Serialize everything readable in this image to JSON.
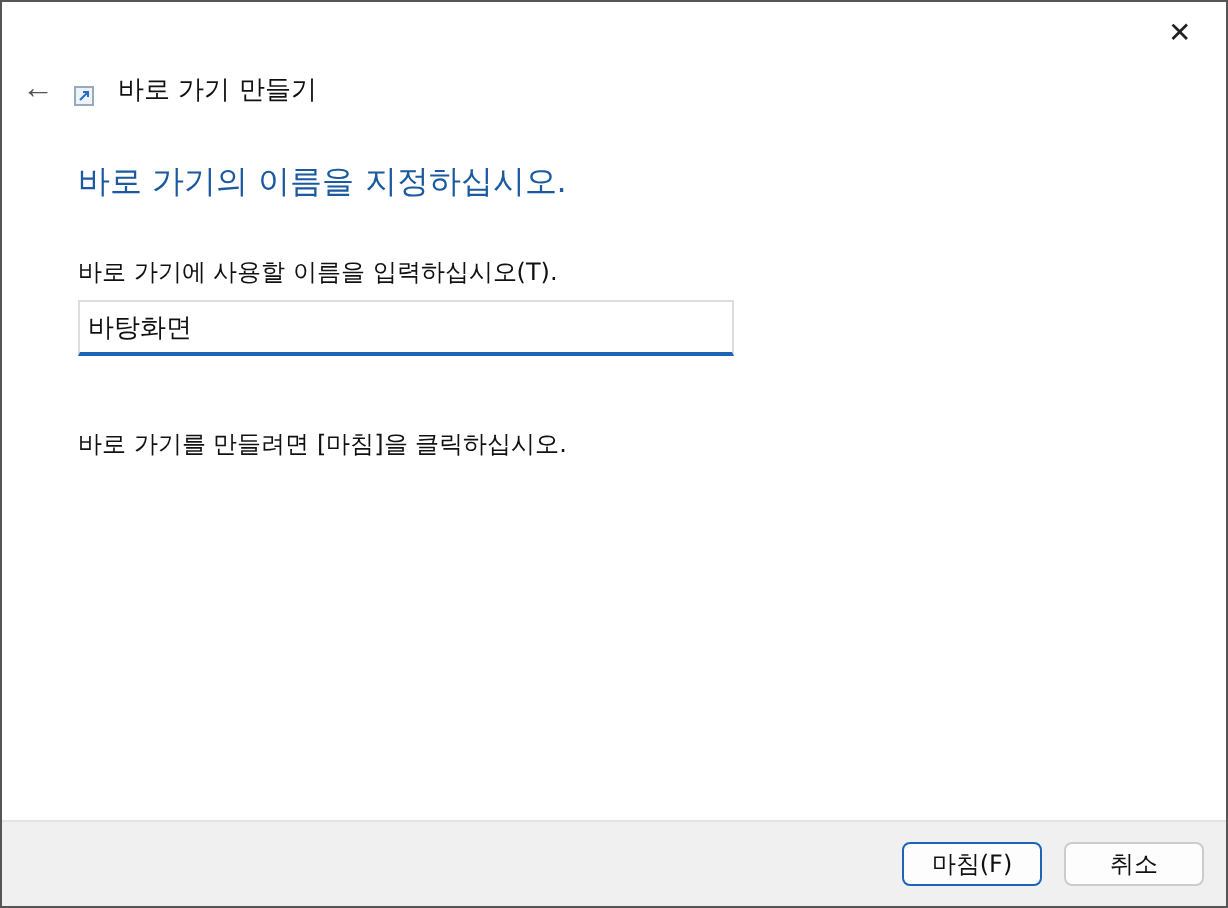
{
  "window": {
    "close": "✕"
  },
  "header": {
    "back": "←",
    "title": "바로 가기 만들기"
  },
  "heading": "바로 가기의 이름을 지정하십시오.",
  "field": {
    "label": "바로 가기에 사용할 이름을 입력하십시오(T).",
    "value": "바탕화면"
  },
  "instruction": "바로 가기를 만들려면 [마침]을 클릭하십시오.",
  "buttons": [
    {
      "label": "마침(F)",
      "default": true
    },
    {
      "label": "취소",
      "default": false
    }
  ]
}
